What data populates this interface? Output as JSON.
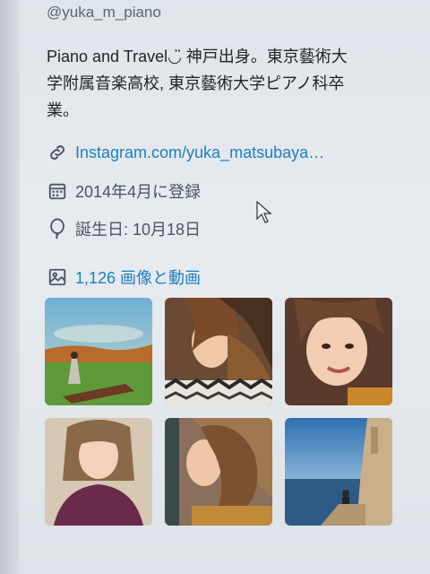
{
  "profile": {
    "handle": "@yuka_m_piano",
    "bio_line1": "Piano and Travel◡̈ 神戸出身。東京藝術大",
    "bio_line2": "学附属音楽高校, 東京藝術大学ピアノ科卒",
    "bio_line3": "業。",
    "link_text": "Instagram.com/yuka_matsubaya…",
    "joined": "2014年4月に登録",
    "birthday": "誕生日: 10月18日",
    "media_label": "1,126 画像と動画"
  },
  "icons": {
    "link": "link-icon",
    "calendar": "calendar-icon",
    "birthday": "balloon-icon",
    "media": "image-icon"
  },
  "colors": {
    "accent": "#1b7fc4",
    "text": "#1e2328",
    "muted": "#4b5560"
  }
}
